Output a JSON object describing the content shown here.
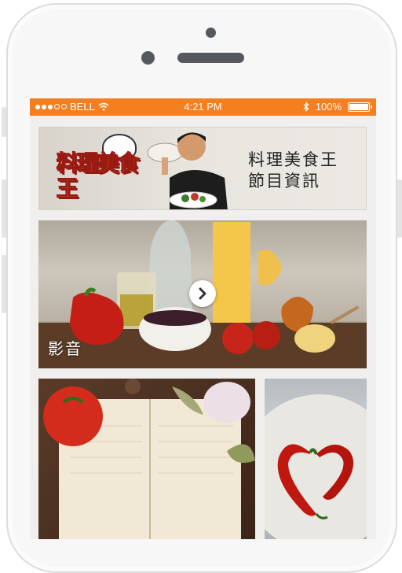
{
  "status_bar": {
    "carrier": "BELL",
    "time": "4:21 PM",
    "battery": "100%"
  },
  "banner": {
    "logo_text": "料理美食王",
    "title_line1": "料理美食王",
    "title_line2": "節目資訊"
  },
  "tiles": [
    {
      "label": "影音"
    }
  ],
  "colors": {
    "status_bar": "#f47f20",
    "screen_bg": "#f1efed"
  }
}
